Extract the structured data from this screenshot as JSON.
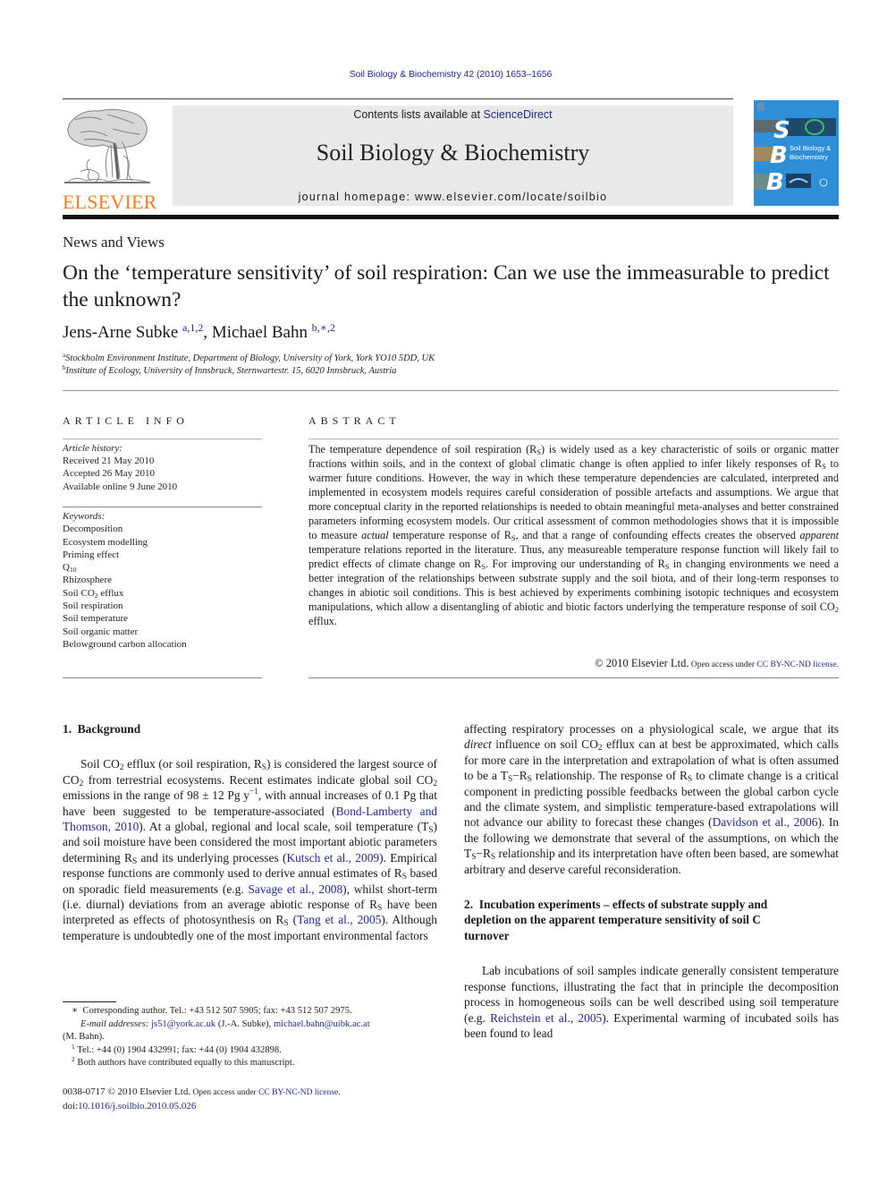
{
  "running_head": "Soil Biology & Biochemistry 42 (2010) 1653–1656",
  "masthead": {
    "publisher_logo_text": "ELSEVIER",
    "contents_prefix": "Contents lists available at ",
    "contents_link": "ScienceDirect",
    "journal_title": "Soil Biology & Biochemistry",
    "homepage": "journal homepage: www.elsevier.com/locate/soilbio",
    "cover": {
      "letters": [
        "S",
        "B",
        "B"
      ],
      "title_line1": "Soil Biology &",
      "title_line2": "Biochemistry",
      "color": "#2f8fd6"
    },
    "logo_color": "#f07f1d"
  },
  "article": {
    "section_type": "News and Views",
    "title": "On the ‘temperature sensitivity’ of soil respiration: Can we use the immeasurable to predict the unknown?",
    "authors": [
      {
        "name": "Jens-Arne Subke",
        "marks": "a,1,2"
      },
      {
        "name": "Michael Bahn",
        "marks": "b,∗,2"
      }
    ],
    "affiliations": [
      {
        "mark": "a",
        "text": "Stockholm Environment Institute, Department of Biology, University of York, York YO10 5DD, UK"
      },
      {
        "mark": "b",
        "text": "Institute of Ecology, University of Innsbruck, Sternwartestr. 15, 6020 Innsbruck, Austria"
      }
    ]
  },
  "article_info": {
    "heading": "ARTICLE INFO",
    "history_label": "Article history:",
    "history": [
      "Received 21 May 2010",
      "Accepted 26 May 2010",
      "Available online 9 June 2010"
    ],
    "keywords_label": "Keywords:",
    "keywords": [
      "Decomposition",
      "Ecosystem modelling",
      "Priming effect",
      "Q",
      "Rhizosphere",
      "Soil CO",
      "Soil respiration",
      "Soil temperature",
      "Soil organic matter",
      "Belowground carbon allocation"
    ],
    "keyword_subscripts": {
      "3": "10",
      "5": "2"
    },
    "keyword_suffixes": {
      "5": " efflux"
    }
  },
  "abstract": {
    "heading": "ABSTRACT",
    "parts": {
      "p1": "The temperature dependence of soil respiration (R",
      "p2": ") is widely used as a key characteristic of soils or organic matter fractions within soils, and in the context of global climatic change is often applied to infer likely responses of R",
      "p3": " to warmer future conditions. However, the way in which these temperature dependencies are calculated, interpreted and implemented in ecosystem models requires careful consideration of possible artefacts and assumptions. We argue that more conceptual clarity in the reported relationships is needed to obtain meaningful meta-analyses and better constrained parameters informing ecosystem models. Our critical assessment of common methodologies shows that it is impossible to measure ",
      "em1": "actual",
      "p4": " temperature response of R",
      "p5": ", and that a range of confounding effects creates the observed ",
      "em2": "apparent",
      "p6": " temperature relations reported in the literature. Thus, any measureable temperature response function will likely fail to predict effects of climate change on R",
      "p7": ". For improving our understanding of R",
      "p8": " in changing environments we need a better integration of the relationships between substrate supply and the soil biota, and of their long-term responses to changes in abiotic soil conditions. This is best achieved by experiments combining isotopic techniques and ecosystem manipulations, which allow a disentangling of abiotic and biotic factors underlying the temperature response of soil CO",
      "p9": " efflux."
    },
    "sub_s": "S",
    "sub_2": "2",
    "copyright": "© 2010 Elsevier Ltd.",
    "open_access_prefix": " Open access under ",
    "license": "CC BY-NC-ND license."
  },
  "body": {
    "section1": {
      "heading": "1. Background",
      "para1": {
        "a": "Soil CO",
        "b": " efflux (or soil respiration, R",
        "c": ") is considered the largest source of CO",
        "d": " from terrestrial ecosystems. Recent estimates indicate global soil CO",
        "e": " emissions in the range of 98 ± 12 Pg y",
        "sup_e": "−1",
        "f": ", with annual increases of 0.1 Pg that have been suggested to be temperature-associated (",
        "cite1": "Bond-Lamberty and Thomson, 2010",
        "g": "). At a global, regional and local scale, soil temperature (T",
        "h": ") and soil moisture have been considered the most important abiotic parameters determining R",
        "i": " and its underlying processes (",
        "cite2": "Kutsch et al., 2009",
        "j": "). Empirical response functions are commonly used to derive annual estimates of R",
        "k": " based on sporadic field measurements (e.g. ",
        "cite3": "Savage et al., 2008",
        "l": "), whilst short-term (i.e. diurnal) deviations from an average abiotic response of R",
        "m": " have been interpreted as effects of photosynthesis on R",
        "n": " (",
        "cite4": "Tang et al., 2005",
        "o": "). Although temperature is undoubtedly one of the most important environmental factors"
      },
      "cont": {
        "a": "affecting respiratory processes on a physiological scale, we argue that its ",
        "em": "direct",
        "b": " influence on soil CO",
        "c": " efflux can at best be approximated, which calls for more care in the interpretation and extrapolation of what is often assumed to be a T",
        "d": "−R",
        "e": " relationship. The response of R",
        "f": " to climate change is a critical component in predicting possible feedbacks between the global carbon cycle and the climate system, and simplistic temperature-based extrapolations will not advance our ability to forecast these changes (",
        "cite": "Davidson et al., 2006",
        "g": "). In the following we demonstrate that several of the assumptions, on which the T",
        "h": "−R",
        "i": " relationship and its interpretation have often been based, are somewhat arbitrary and deserve careful reconsideration."
      }
    },
    "section2": {
      "heading": "2. Incubation experiments – effects of substrate supply and depletion on the apparent temperature sensitivity of soil C turnover",
      "para1": {
        "a": "Lab incubations of soil samples indicate generally consistent temperature response functions, illustrating the fact that in principle the decomposition process in homogeneous soils can be well described using soil temperature (e.g. ",
        "cite": "Reichstein et al., 2005",
        "b": "). Experimental warming of incubated soils has been found to lead"
      }
    }
  },
  "footnotes": {
    "corresponding": "∗ Corresponding author. Tel.: +43 512 507 5905; fax: +43 512 507 2975.",
    "email_label": "E-mail addresses:",
    "email1": "js51@york.ac.uk",
    "email1_owner": " (J.-A. Subke), ",
    "email2": "michael.bahn@uibk.ac.at",
    "email2_owner": "(M. Bahn).",
    "fn1_mark": "1",
    "fn1": "Tel.: +44 (0) 1904 432991; fax: +44 (0) 1904 432898.",
    "fn2_mark": "2",
    "fn2": "Both authors have contributed equally to this manuscript."
  },
  "issn": {
    "line1_prefix": "0038-0717 © 2010 Elsevier Ltd.",
    "open_access_prefix": " Open access under ",
    "license": "CC BY-NC-ND license.",
    "doi_prefix": "doi:",
    "doi": "10.1016/j.soilbio.2010.05.026"
  }
}
